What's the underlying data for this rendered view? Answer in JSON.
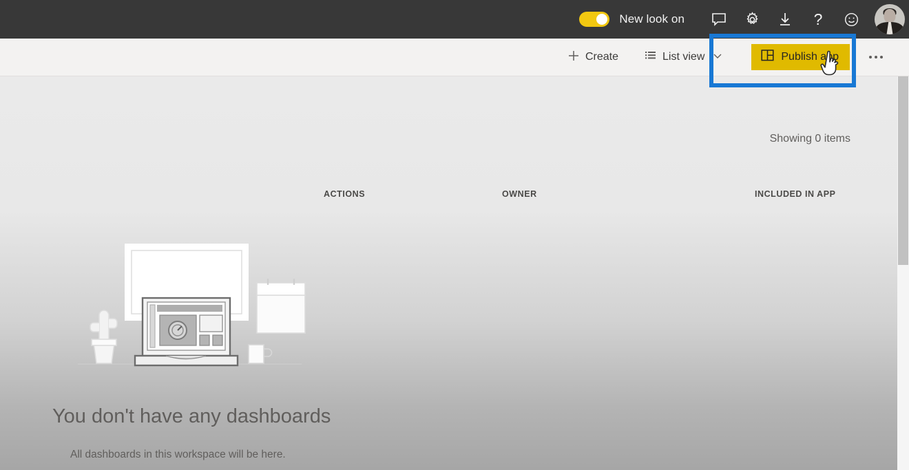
{
  "topbar": {
    "toggle": {
      "name": "new-look-toggle",
      "state": "on"
    },
    "new_look_label": "New look on",
    "icons": [
      {
        "name": "feedback-chat-icon",
        "glyph": "chat-bubble"
      },
      {
        "name": "settings-gear-icon",
        "glyph": "gear"
      },
      {
        "name": "download-icon",
        "glyph": "download-arrow"
      },
      {
        "name": "help-icon",
        "glyph": "question-mark",
        "label": "?"
      },
      {
        "name": "smiley-feedback-icon",
        "glyph": "smiley-face"
      }
    ],
    "help_label": "?",
    "avatar_name": "user-avatar"
  },
  "commandbar": {
    "create_label": "Create",
    "listview_label": "List view",
    "publish_label": "Publish app",
    "more_label": "···"
  },
  "content": {
    "showing_items": "Showing 0 items",
    "columns": [
      {
        "key": "actions",
        "label": "ACTIONS"
      },
      {
        "key": "owner",
        "label": "OWNER"
      },
      {
        "key": "included",
        "label": "INCLUDED IN APP"
      }
    ],
    "empty_state": {
      "title": "You don't have any dashboards",
      "subtitle": "All dashboards in this workspace will be here."
    }
  },
  "colors": {
    "topbar_bg": "#383838",
    "cmdbar_bg": "#f3f2f1",
    "accent_yellow": "#e0ba00",
    "toggle_yellow": "#f2c811",
    "highlight_blue": "#1878d4",
    "text_gray": "#605e5c"
  }
}
